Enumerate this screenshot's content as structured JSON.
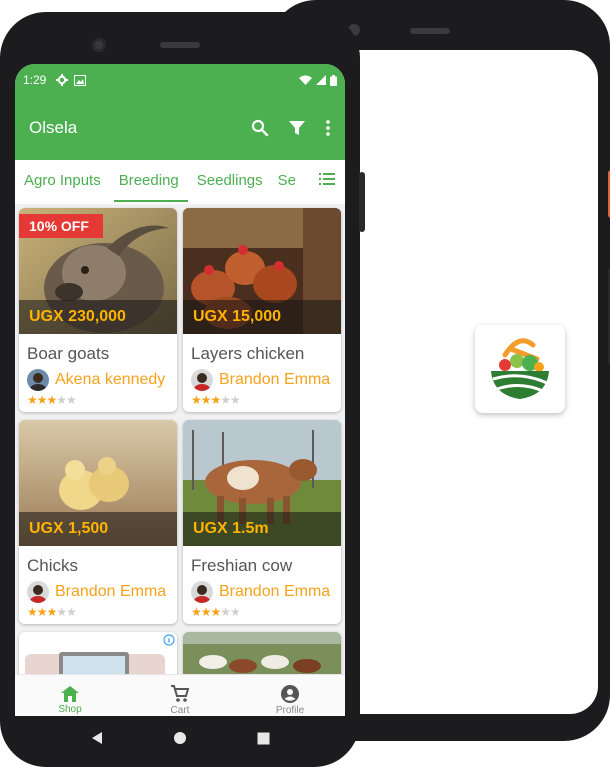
{
  "status_bar": {
    "time": "1:29"
  },
  "app_bar": {
    "title": "Olsela"
  },
  "tabs": [
    {
      "label": "Agro Inputs",
      "active": false
    },
    {
      "label": "Breeding",
      "active": true
    },
    {
      "label": "Seedlings",
      "active": false
    },
    {
      "label": "Se",
      "active": false
    }
  ],
  "products": [
    {
      "name": "Boar goats",
      "price": "UGX 230,000",
      "seller": "Akena kennedy",
      "rating": 3,
      "discount": "10% OFF"
    },
    {
      "name": "Layers chicken",
      "price": "UGX 15,000",
      "seller": "Brandon Emma",
      "rating": 3
    },
    {
      "name": "Chicks",
      "price": "UGX 1,500",
      "seller": "Brandon Emma",
      "rating": 3
    },
    {
      "name": "Freshian cow",
      "price": "UGX 1.5m",
      "seller": "Brandon Emma",
      "rating": 3
    }
  ],
  "bottom_nav": [
    {
      "label": "Shop",
      "icon": "home-icon",
      "active": true
    },
    {
      "label": "Cart",
      "icon": "cart-icon",
      "active": false
    },
    {
      "label": "Profile",
      "icon": "account-circle-icon",
      "active": false
    }
  ],
  "colors": {
    "primary": "#4caf50",
    "accent": "#f7a21b",
    "discount": "#e53935",
    "price": "#ffb300"
  }
}
